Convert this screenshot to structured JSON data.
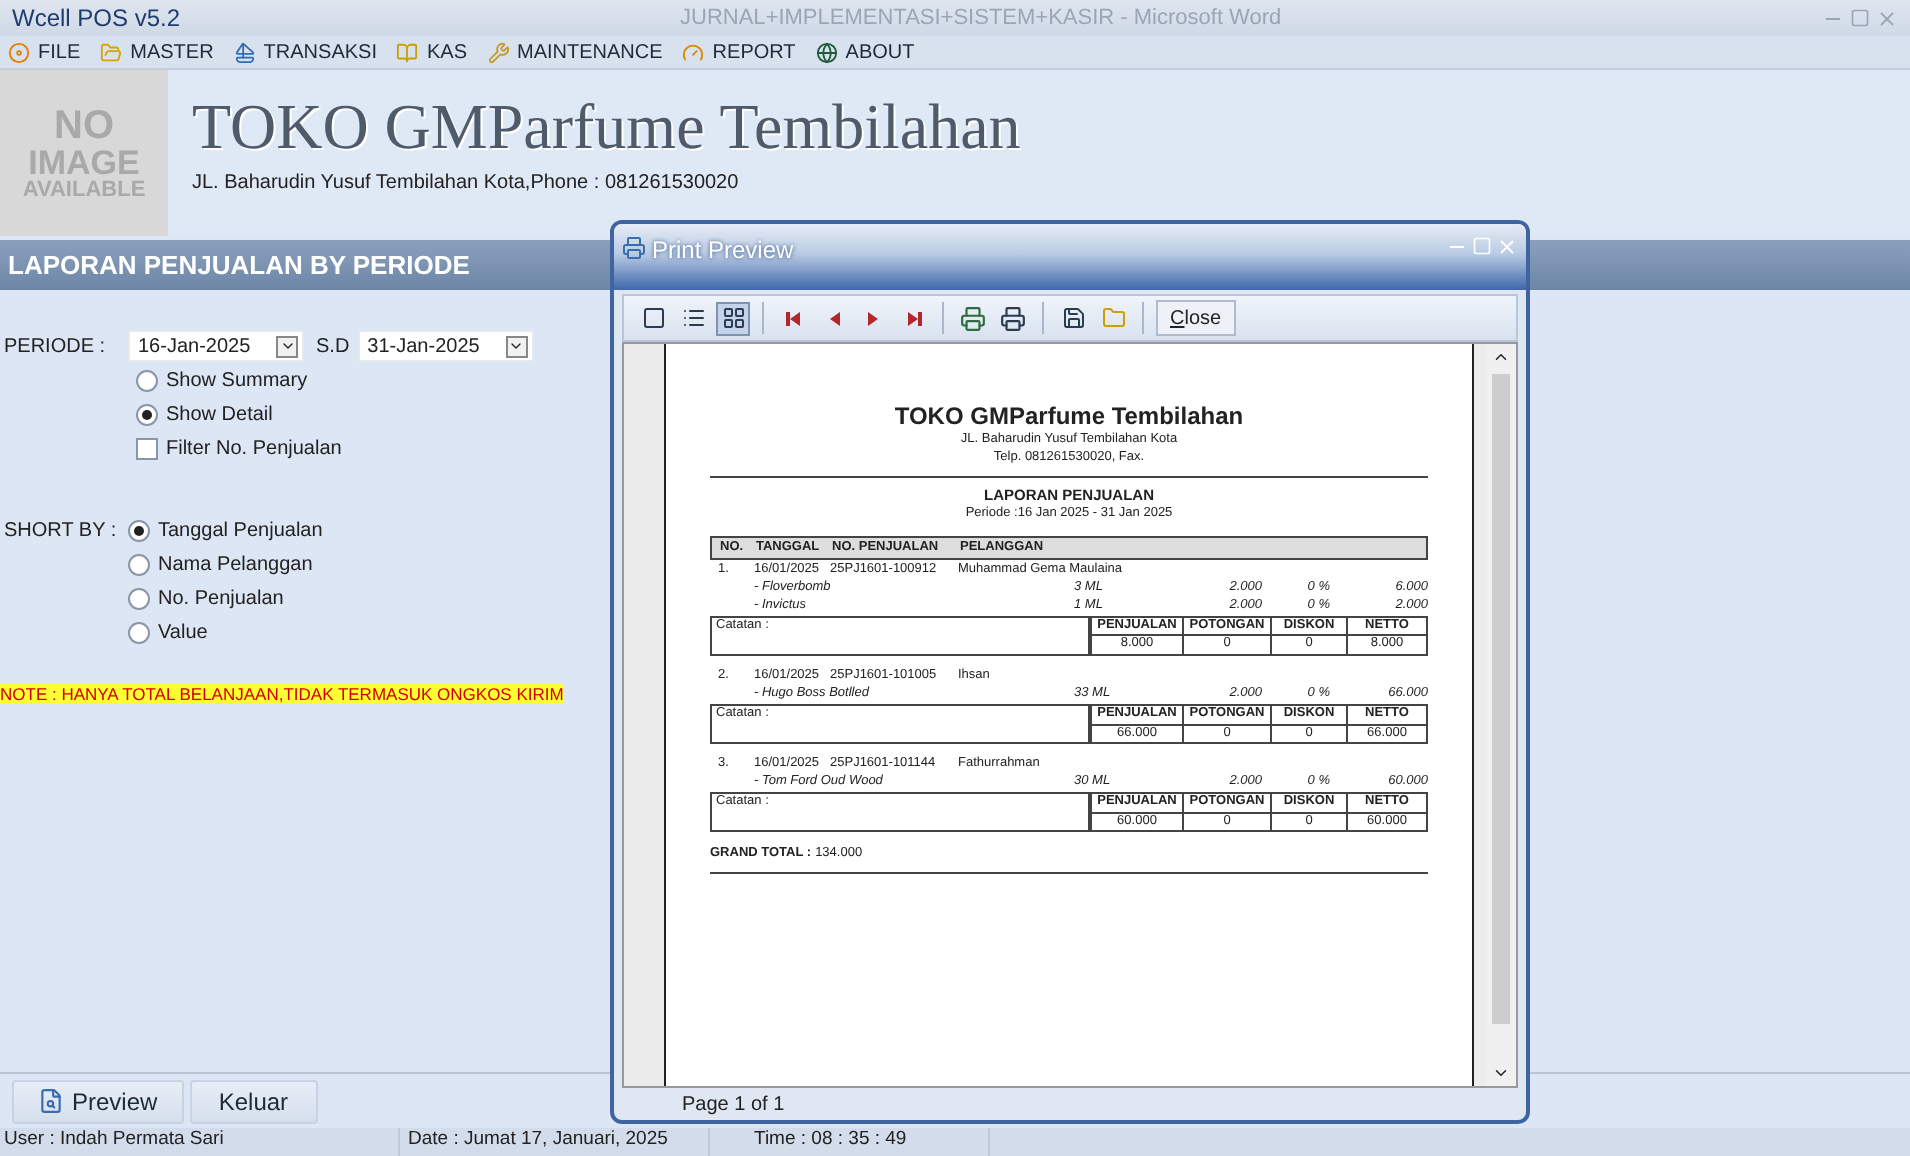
{
  "window": {
    "title": "Wcell POS v5.2",
    "document_title": "JURNAL+IMPLEMENTASI+SISTEM+KASIR - Microsoft Word"
  },
  "menu": [
    "FILE",
    "MASTER",
    "TRANSAKSI",
    "KAS",
    "MAINTENANCE",
    "REPORT",
    "ABOUT"
  ],
  "header": {
    "logo_lines": [
      "NO",
      "IMAGE",
      "AVAILABLE"
    ],
    "store_name": "TOKO GMParfume Tembilahan",
    "address": "JL. Baharudin Yusuf Tembilahan Kota,Phone : 081261530020"
  },
  "section_title": "LAPORAN PENJUALAN BY PERIODE",
  "form": {
    "period_label": "PERIODE  :",
    "date_from": "16-Jan-2025",
    "until_label": "S.D",
    "date_to": "31-Jan-2025",
    "view_options": [
      {
        "label": "Show Summary",
        "selected": false
      },
      {
        "label": "Show Detail",
        "selected": true
      }
    ],
    "filter": {
      "label": "Filter No. Penjualan",
      "checked": false
    },
    "sort_label": "SHORT BY :",
    "sort_options": [
      {
        "label": "Tanggal Penjualan",
        "selected": true
      },
      {
        "label": "Nama Pelanggan",
        "selected": false
      },
      {
        "label": "No. Penjualan",
        "selected": false
      },
      {
        "label": "Value",
        "selected": false
      }
    ],
    "note": "NOTE : HANYA TOTAL BELANJAAN,TIDAK TERMASUK ONGKOS KIRIM"
  },
  "buttons": [
    "Preview",
    "Keluar"
  ],
  "status_bar": [
    "User : Indah Permata Sari",
    "Date : Jumat 17, Januari, 2025",
    "Time : 08 : 35 : 49"
  ],
  "preview": {
    "title": "Print Preview",
    "view_buttons": [
      {
        "selected": false
      },
      {
        "selected": false
      },
      {
        "selected": true
      }
    ],
    "close_label": "Close",
    "page_info": "Page 1 of 1",
    "report": {
      "store_name": "TOKO GMParfume Tembilahan",
      "address": "JL. Baharudin Yusuf Tembilahan Kota",
      "phone": "Telp. 081261530020, Fax.",
      "heading": "LAPORAN PENJUALAN",
      "period": "Periode :16 Jan 2025 - 31 Jan 2025",
      "columns": [
        "NO.",
        "TANGGAL",
        "NO. PENJUALAN",
        "PELANGGAN"
      ],
      "transactions": [
        {
          "no": "1.",
          "date": "16/01/2025",
          "invoice": "25PJ1601-100912",
          "customer": "Muhammad Gema Maulaina",
          "items": [
            {
              "name": "- Floverbomb",
              "qty": "3 ML",
              "price": "2.000",
              "discount": "0 %",
              "total": "6.000"
            },
            {
              "name": "- Invictus",
              "qty": "1 ML",
              "price": "2.000",
              "discount": "0 %",
              "total": "2.000"
            }
          ],
          "note_label": "Catatan :",
          "summary_columns": [
            "PENJUALAN",
            "POTONGAN",
            "DISKON",
            "NETTO"
          ],
          "summary_values": [
            "8.000",
            "0",
            "0",
            "8.000"
          ]
        },
        {
          "no": "2.",
          "date": "16/01/2025",
          "invoice": "25PJ1601-101005",
          "customer": "Ihsan",
          "items": [
            {
              "name": "- Hugo Boss Botlled",
              "qty": "33 ML",
              "price": "2.000",
              "discount": "0 %",
              "total": "66.000"
            }
          ],
          "note_label": "Catatan :",
          "summary_columns": [
            "PENJUALAN",
            "POTONGAN",
            "DISKON",
            "NETTO"
          ],
          "summary_values": [
            "66.000",
            "0",
            "0",
            "66.000"
          ]
        },
        {
          "no": "3.",
          "date": "16/01/2025",
          "invoice": "25PJ1601-101144",
          "customer": "Fathurrahman",
          "items": [
            {
              "name": "- Tom Ford Oud Wood",
              "qty": "30 ML",
              "price": "2.000",
              "discount": "0 %",
              "total": "60.000"
            }
          ],
          "note_label": "Catatan :",
          "summary_columns": [
            "PENJUALAN",
            "POTONGAN",
            "DISKON",
            "NETTO"
          ],
          "summary_values": [
            "60.000",
            "0",
            "0",
            "60.000"
          ]
        }
      ],
      "grand_total_label": "GRAND TOTAL :",
      "grand_total": "134.000"
    }
  }
}
